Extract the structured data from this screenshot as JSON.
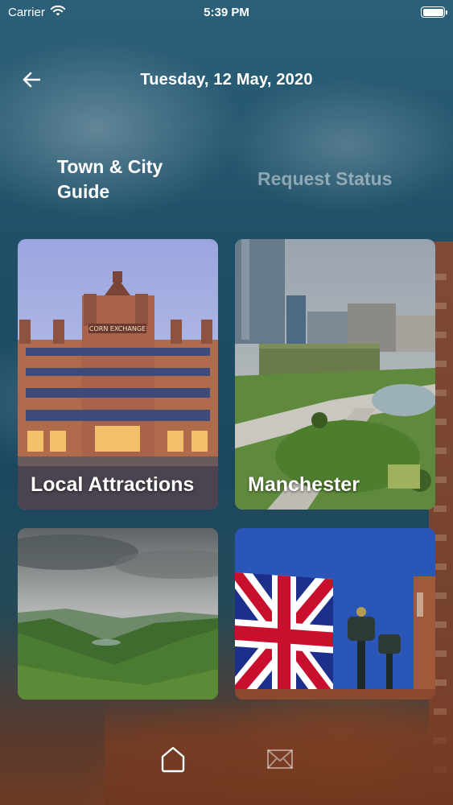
{
  "status_bar": {
    "carrier": "Carrier",
    "time": "5:39 PM",
    "battery_level": 1.0
  },
  "header": {
    "title": "Tuesday, 12 May, 2020",
    "back_icon": "arrow-left-icon"
  },
  "tabs": [
    {
      "label": "Town & City Guide",
      "active": true
    },
    {
      "label": "Request Status",
      "active": false
    }
  ],
  "cards": [
    {
      "label": "Local Attractions",
      "image": "corn-exchange-building"
    },
    {
      "label": "Manchester",
      "image": "city-park-aerial"
    },
    {
      "label": "",
      "image": "green-hills-landscape"
    },
    {
      "label": "",
      "image": "union-jack-flag"
    }
  ],
  "bottom_nav": {
    "items": [
      {
        "icon": "home-icon",
        "active": true
      },
      {
        "icon": "mail-icon",
        "active": false
      }
    ]
  },
  "colors": {
    "accent_text": "#ffffff",
    "inactive_tab": "#ffffff73",
    "background": "#1f5068"
  }
}
